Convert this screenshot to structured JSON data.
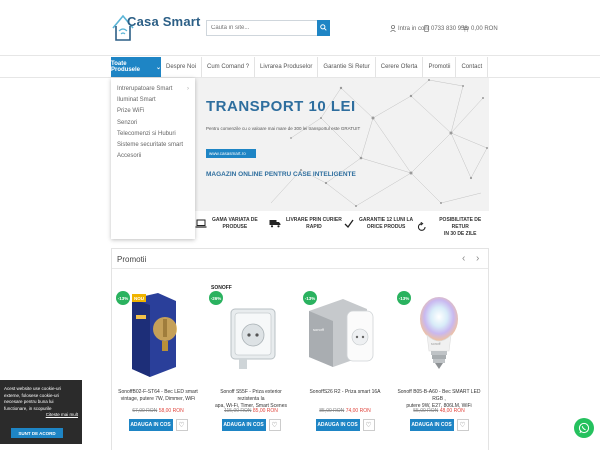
{
  "header": {
    "logo_text": "Casa Smart",
    "search_placeholder": "Cauta in site...",
    "account_label": "Intra in cont",
    "phone": "0733 830 958",
    "cart_total": "0,00 RON"
  },
  "nav": {
    "main_label": "Toate Produsele",
    "items": [
      "Despre Noi",
      "Cum Comand ?",
      "Livrarea Produselor",
      "Garantie Si Retur",
      "Cerere Oferta",
      "Promotii",
      "Contact"
    ]
  },
  "dropdown": {
    "items": [
      "Intrerupatoare Smart",
      "Iluminat Smart",
      "Prize WiFi",
      "Senzori",
      "Telecomenzi si Huburi",
      "Sisteme securitate smart",
      "Accesorii"
    ]
  },
  "banner": {
    "title": "TRANSPORT 10 LEI",
    "subtitle": "Pentru comenzile cu o valoare mai mare de 300 lei transportul este GRATUIT",
    "url": "www.casasmart.ro",
    "tagline": "MAGAZIN ONLINE PENTRU CASE INTELIGENTE"
  },
  "features": [
    {
      "l1": "GAMA VARIATA DE",
      "l2": "PRODUSE"
    },
    {
      "l1": "LIVRARE PRIN CURIER",
      "l2": "RAPID"
    },
    {
      "l1": "GARANTIE 12 LUNI LA",
      "l2": "ORICE PRODUS"
    },
    {
      "l1": "POSIBILITATE DE RETUR",
      "l2": "IN 30 DE ZILE"
    }
  ],
  "promo": {
    "title": "Promotii",
    "add_label": "ADAUGA IN COS",
    "products": [
      {
        "discount": "-13%",
        "extra_badge": "NOU",
        "name1": "SonoffB02-F-ST64 - Bec LED smart",
        "name2": "vintage, putere 7W, Dimmer, WiFi",
        "old": "67,00 RON",
        "new": "58,00 RON"
      },
      {
        "discount": "-26%",
        "extra_badge": "",
        "brand": "SONOFF",
        "name1": "Sonoff S55F - Priza exterior rezistenta la",
        "name2": "apa, Wi-Fi, Timer, Smart Scenes",
        "old": "115,00 RON",
        "new": "85,00 RON"
      },
      {
        "discount": "-13%",
        "extra_badge": "",
        "name1": "SonoffS26 R2 - Priza smart 16A",
        "name2": "",
        "old": "85,00 RON",
        "new": "74,00 RON"
      },
      {
        "discount": "-13%",
        "extra_badge": "",
        "name1": "Sonoff B05-B-A60 - Bec SMART LED RGB ,",
        "name2": "putere 9W, E27, 806LM, WiFi",
        "old": "55,00 RON",
        "new": "48,00 RON"
      }
    ]
  },
  "cookie": {
    "text": "Acest website use cookie-uri externe, folosese cookie-uri necesare pentru buna lui functionare, in scopurile",
    "link": "Citeste mai mult",
    "button": "SUNT DE ACORD"
  },
  "colors": {
    "accent": "#1e85c5",
    "discount": "#2ab25f",
    "price_new": "#e0453d"
  }
}
